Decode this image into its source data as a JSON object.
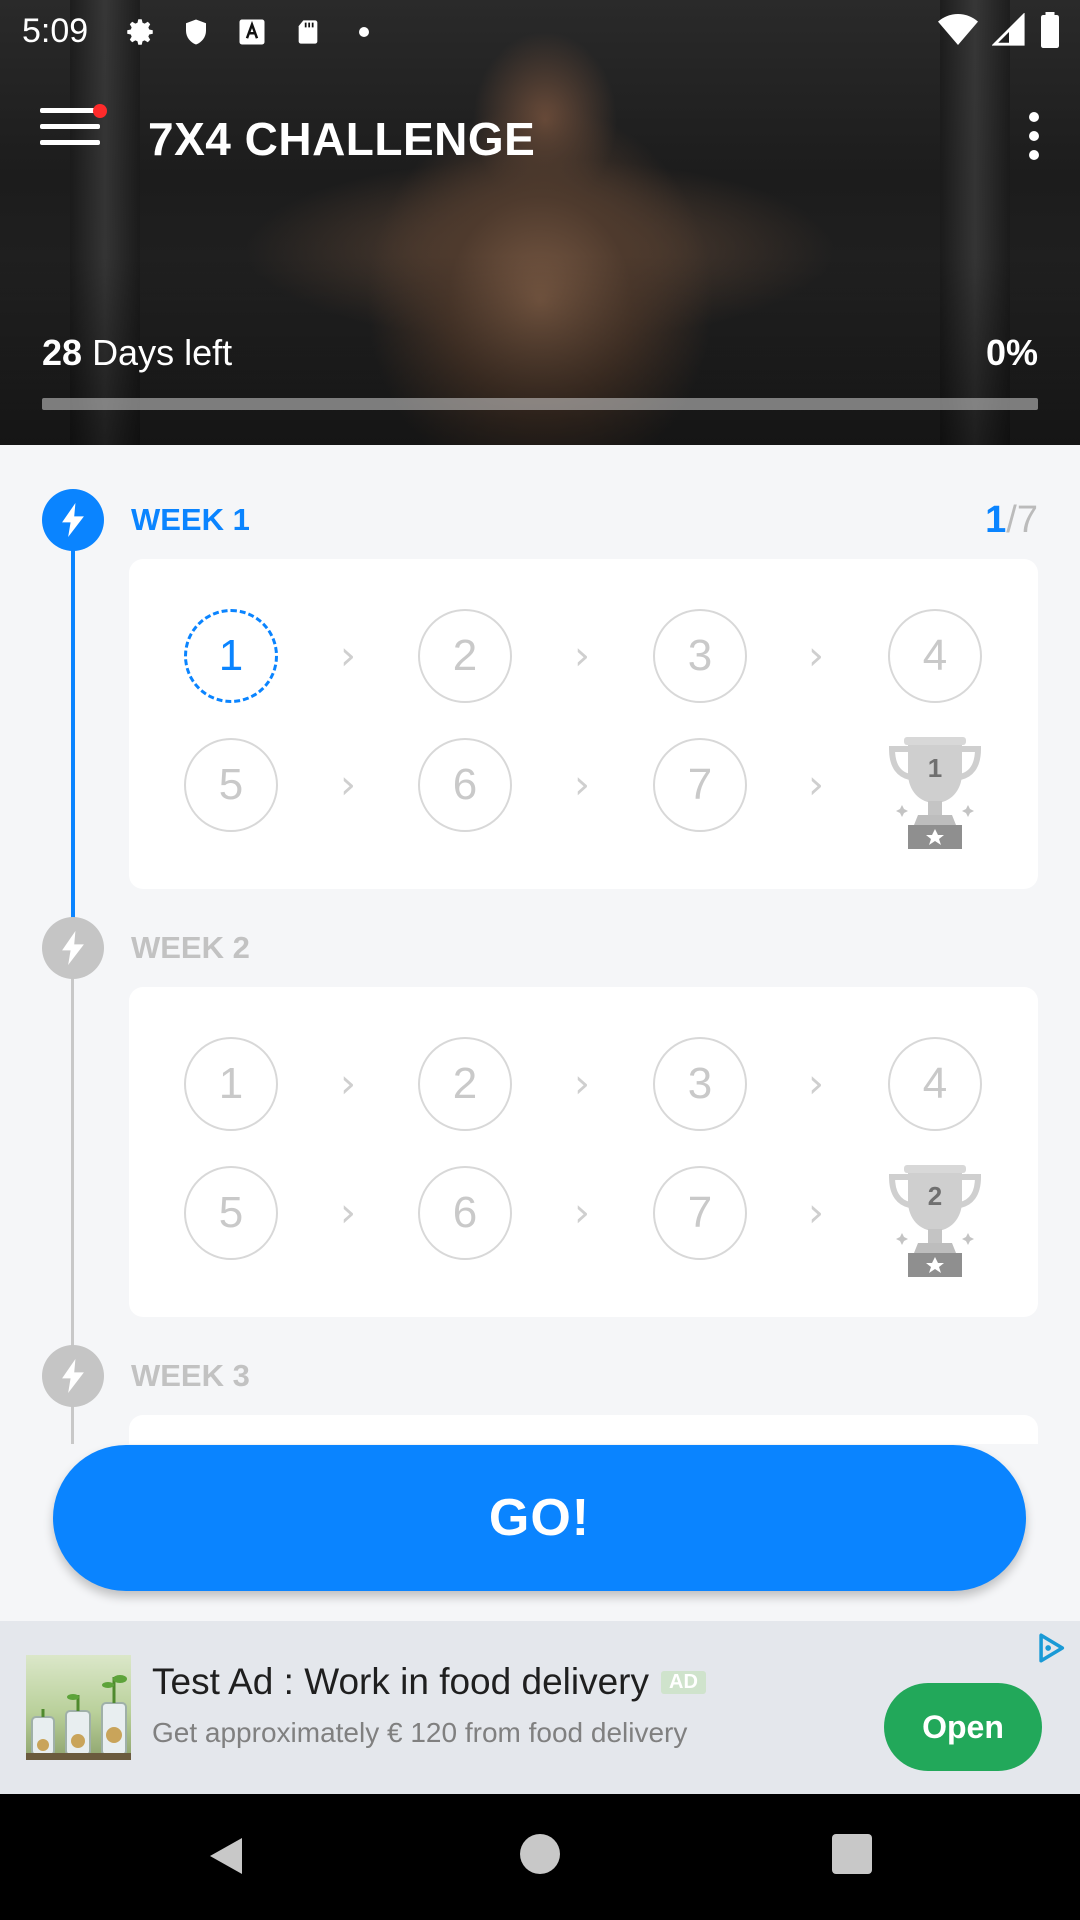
{
  "status_bar": {
    "time": "5:09"
  },
  "header": {
    "title": "7X4 CHALLENGE",
    "days_left_number": "28",
    "days_left_text": "Days left",
    "progress_percent_label": "0%",
    "progress": 0
  },
  "weeks": [
    {
      "label": "WEEK 1",
      "progress_done": "1",
      "progress_total": "/7",
      "days": [
        "1",
        "2",
        "3",
        "4",
        "5",
        "6",
        "7"
      ],
      "trophy": "1",
      "state": "active"
    },
    {
      "label": "WEEK 2",
      "days": [
        "1",
        "2",
        "3",
        "4",
        "5",
        "6",
        "7"
      ],
      "trophy": "2",
      "state": "inactive"
    },
    {
      "label": "WEEK 3",
      "state": "inactive"
    }
  ],
  "go_button": {
    "label": "GO!"
  },
  "ad": {
    "title": "Test Ad : Work in food delivery",
    "tag": "AD",
    "subtitle": "Get approximately € 120 from food delivery",
    "button_label": "Open"
  },
  "colors": {
    "accent": "#0a84ff",
    "ad_button": "#22a85a",
    "inactive": "#c5c5c5"
  }
}
